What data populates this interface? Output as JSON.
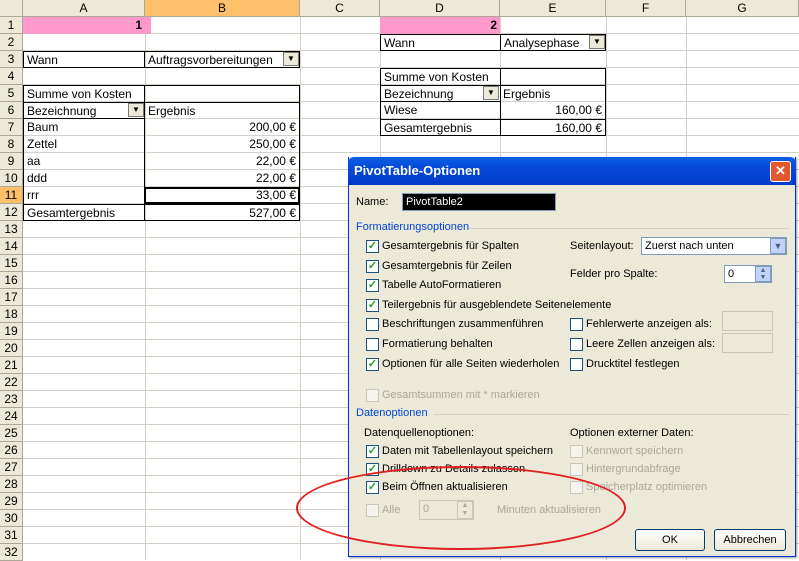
{
  "columns": [
    "A",
    "B",
    "C",
    "D",
    "E",
    "F",
    "G"
  ],
  "rows": [
    "1",
    "2",
    "3",
    "4",
    "5",
    "6",
    "7",
    "8",
    "9",
    "10",
    "11",
    "12",
    "13",
    "14",
    "15",
    "16",
    "17",
    "18",
    "19",
    "20",
    "21",
    "22",
    "23",
    "24",
    "25",
    "26",
    "27",
    "28",
    "29",
    "30",
    "31",
    "32"
  ],
  "colors": {
    "pink_header": "#ff99cc",
    "selection_header": "#ffc06b",
    "dialog_title": "#0549d6",
    "annotation": "#e02020"
  },
  "pivot1": {
    "marker": "1",
    "filter_label": "Wann",
    "filter_value": "Auftragsvorbereitungen",
    "data_field": "Summe von Kosten",
    "row_field": "Bezeichnung",
    "result_header": "Ergebnis",
    "items": [
      {
        "name": "Baum",
        "value": "200,00 €"
      },
      {
        "name": "Zettel",
        "value": "250,00 €"
      },
      {
        "name": "aa",
        "value": "22,00 €"
      },
      {
        "name": "ddd",
        "value": "22,00 €"
      },
      {
        "name": "rrr",
        "value": "33,00 €"
      }
    ],
    "total_label": "Gesamtergebnis",
    "total_value": "527,00 €"
  },
  "pivot2": {
    "marker": "2",
    "filter_label": "Wann",
    "filter_value": "Analysephase",
    "data_field": "Summe von Kosten",
    "row_field": "Bezeichnung",
    "result_header": "Ergebnis",
    "items": [
      {
        "name": "Wiese",
        "value": "160,00 €"
      }
    ],
    "total_label": "Gesamtergebnis",
    "total_value": "160,00 €"
  },
  "dialog": {
    "title": "PivotTable-Optionen",
    "close_icon": "close-icon",
    "name_label": "Name:",
    "name_value": "PivotTable2",
    "format_group": "Formatierungsoptionen",
    "format_options": {
      "grand_totals_columns": "Gesamtergebnis für Spalten",
      "grand_totals_rows": "Gesamtergebnis für Zeilen",
      "autoformat": "Tabelle AutoFormatieren",
      "subtotal_hidden": "Teilergebnis für ausgeblendete Seitenelemente",
      "merge_labels": "Beschriftungen zusammenführen",
      "keep_format": "Formatierung behalten",
      "repeat_options": "Optionen für alle Seiten wiederholen",
      "mark_totals": "Gesamtsummen mit * markieren"
    },
    "page_layout_label": "Seitenlayout:",
    "page_layout_value": "Zuerst nach unten",
    "fields_per_column_label": "Felder pro Spalte:",
    "fields_per_column_value": "0",
    "error_values_label": "Fehlerwerte anzeigen als:",
    "empty_cells_label": "Leere Zellen anzeigen als:",
    "print_titles_label": "Drucktitel festlegen",
    "data_group": "Datenoptionen",
    "source_options_label": "Datenquellenoptionen:",
    "external_options_label": "Optionen externer Daten:",
    "save_data": "Daten mit Tabellenlayout speichern",
    "drilldown": "Drilldown zu Details zulassen",
    "refresh_on_open": "Beim Öffnen aktualisieren",
    "all_label": "Alle",
    "minutes_value": "0",
    "minutes_label": "Minuten aktualisieren",
    "save_password": "Kennwort speichern",
    "background_query": "Hintergrundabfrage",
    "optimize_memory": "Speicherplatz optimieren",
    "ok_label": "OK",
    "cancel_label": "Abbrechen"
  }
}
